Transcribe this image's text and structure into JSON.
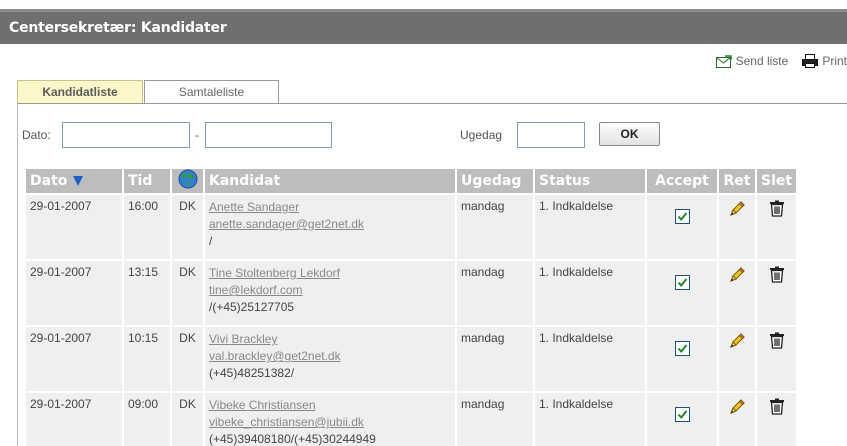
{
  "header": {
    "title": "Centersekretær: Kandidater"
  },
  "actions": {
    "send_list": "Send liste",
    "print": "Print"
  },
  "tabs": [
    {
      "label": "Kandidatliste",
      "active": true
    },
    {
      "label": "Samtaleliste",
      "active": false
    }
  ],
  "filters": {
    "date_label": "Dato:",
    "date_sep": "-",
    "date_from": "",
    "date_to": "",
    "weekday_label": "Ugedag",
    "weekday_value": "",
    "ok_label": "OK"
  },
  "table": {
    "columns": {
      "date": "Dato",
      "time": "Tid",
      "country_icon": "globe-icon",
      "candidate": "Kandidat",
      "weekday": "Ugedag",
      "status": "Status",
      "accept": "Accept",
      "edit": "Ret",
      "delete": "Slet"
    },
    "sort": {
      "column": "Dato",
      "direction": "descending"
    },
    "rows": [
      {
        "date": "29-01-2007",
        "time": "16:00",
        "country": "DK",
        "name": "Anette Sandager",
        "email": "anette.sandager@get2net.dk",
        "phone": "/",
        "weekday": "mandag",
        "status": "1. Indkaldelse",
        "accepted": true
      },
      {
        "date": "29-01-2007",
        "time": "13:15",
        "country": "DK",
        "name": "Tine Stoltenberg Lekdorf",
        "email": "tine@lekdorf.com",
        "phone": "/(+45)25127705",
        "weekday": "mandag",
        "status": "1. Indkaldelse",
        "accepted": true
      },
      {
        "date": "29-01-2007",
        "time": "10:15",
        "country": "DK",
        "name": "Vivi Brackley",
        "email": "val.brackley@get2net.dk",
        "phone": "(+45)48251382/",
        "weekday": "mandag",
        "status": "1. Indkaldelse",
        "accepted": true
      },
      {
        "date": "29-01-2007",
        "time": "09:00",
        "country": "DK",
        "name": "Vibeke Christiansen",
        "email": "vibeke_christiansen@jubii.dk",
        "phone": "(+45)39408180/(+45)30244949",
        "weekday": "mandag",
        "status": "1. Indkaldelse",
        "accepted": true
      }
    ]
  },
  "colors": {
    "title_bar": "#6f6f6f",
    "active_tab": "#fcf7c9",
    "header_cell": "#bdbdbd",
    "row_cell": "#efefef",
    "sort_arrow": "#1f5fc8",
    "link": "#888888"
  }
}
